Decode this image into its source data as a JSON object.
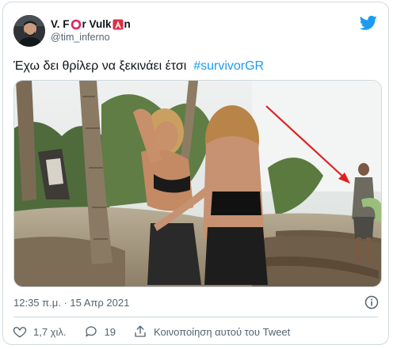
{
  "author": {
    "name_parts": [
      "V. F",
      "r Vulk",
      "n"
    ],
    "handle": "@tim_inferno"
  },
  "tweet": {
    "text": "Έχω δει θρίλερ να ξεκινάει έτσι",
    "hashtag": "#survivorGR"
  },
  "meta": {
    "timestamp": "12:35 π.μ. · 15 Απρ 2021"
  },
  "actions": {
    "likes": "1,7 χιλ.",
    "replies": "19",
    "share_label": "Κοινοποίηση αυτού του Tweet"
  },
  "icons": [
    "avatar",
    "heavy-circle-icon",
    "a-button-icon",
    "twitter-logo-icon",
    "info-icon",
    "heart-icon",
    "reply-icon",
    "share-icon"
  ],
  "colors": {
    "accent": "#1d9bf0",
    "secondary_text": "#536471",
    "emoji_red": "#e0245e"
  }
}
